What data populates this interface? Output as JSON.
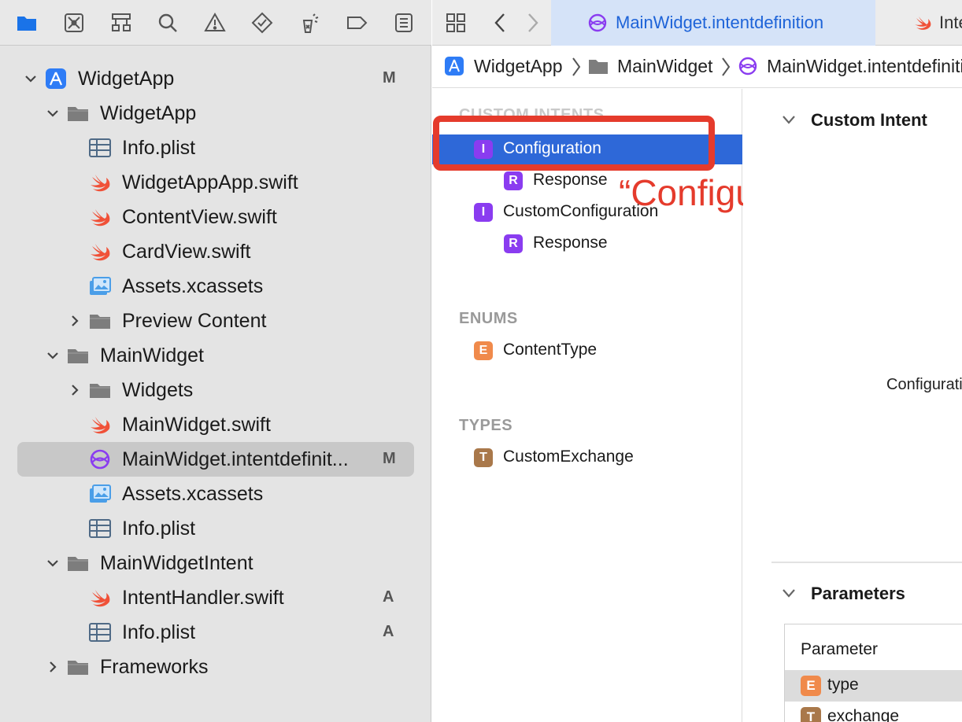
{
  "colors": {
    "accent": "#2e68d8",
    "tab_active_bg": "#d5e3f8",
    "annotation_red": "#e53b2c",
    "intent_purple": "#8a3cf0",
    "enum_orange": "#f08a4b",
    "type_brown": "#a9784a",
    "swift_orange": "#f05138"
  },
  "navigator": {
    "toolbar_icons": [
      "folder-icon",
      "source-control-icon",
      "hierarchy-icon",
      "search-icon",
      "warning-icon",
      "test-icon",
      "debug-icon",
      "breakpoint-icon",
      "report-icon"
    ],
    "tree": [
      {
        "label": "WidgetApp",
        "icon": "app-project-icon",
        "depth": 0,
        "chevron": "down",
        "badge": "M"
      },
      {
        "label": "WidgetApp",
        "icon": "folder-icon",
        "depth": 1,
        "chevron": "down",
        "badge": ""
      },
      {
        "label": "Info.plist",
        "icon": "plist-icon",
        "depth": 2,
        "chevron": "",
        "badge": ""
      },
      {
        "label": "WidgetAppApp.swift",
        "icon": "swift-icon",
        "depth": 2,
        "chevron": "",
        "badge": ""
      },
      {
        "label": "ContentView.swift",
        "icon": "swift-icon",
        "depth": 2,
        "chevron": "",
        "badge": ""
      },
      {
        "label": "CardView.swift",
        "icon": "swift-icon",
        "depth": 2,
        "chevron": "",
        "badge": ""
      },
      {
        "label": "Assets.xcassets",
        "icon": "assets-icon",
        "depth": 2,
        "chevron": "",
        "badge": ""
      },
      {
        "label": "Preview Content",
        "icon": "folder-icon",
        "depth": 2,
        "chevron": "right",
        "badge": ""
      },
      {
        "label": "MainWidget",
        "icon": "folder-icon",
        "depth": 1,
        "chevron": "down",
        "badge": ""
      },
      {
        "label": "Widgets",
        "icon": "folder-icon",
        "depth": 2,
        "chevron": "right",
        "badge": ""
      },
      {
        "label": "MainWidget.swift",
        "icon": "swift-icon",
        "depth": 2,
        "chevron": "",
        "badge": ""
      },
      {
        "label": "MainWidget.intentdefinit...",
        "icon": "intent-definition-icon",
        "depth": 2,
        "chevron": "",
        "badge": "M",
        "selected": true
      },
      {
        "label": "Assets.xcassets",
        "icon": "assets-icon",
        "depth": 2,
        "chevron": "",
        "badge": ""
      },
      {
        "label": "Info.plist",
        "icon": "plist-icon",
        "depth": 2,
        "chevron": "",
        "badge": ""
      },
      {
        "label": "MainWidgetIntent",
        "icon": "folder-icon",
        "depth": 1,
        "chevron": "down",
        "badge": ""
      },
      {
        "label": "IntentHandler.swift",
        "icon": "swift-icon",
        "depth": 2,
        "chevron": "",
        "badge": "A"
      },
      {
        "label": "Info.plist",
        "icon": "plist-icon",
        "depth": 2,
        "chevron": "",
        "badge": "A"
      },
      {
        "label": "Frameworks",
        "icon": "folder-icon",
        "depth": 1,
        "chevron": "right",
        "badge": ""
      }
    ]
  },
  "tabs": {
    "active_label": "MainWidget.intentdefinition",
    "other_label": "IntentHandler.swift"
  },
  "breadcrumb": {
    "project": "WidgetApp",
    "group": "MainWidget",
    "file": "MainWidget.intentdefinition"
  },
  "intent_list": {
    "custom_intents_header": "CUSTOM INTENTS",
    "items": [
      {
        "chip": "I",
        "label": "Configuration",
        "kind": "intent",
        "selected": true
      },
      {
        "chip": "R",
        "label": "Response",
        "kind": "response"
      },
      {
        "chip": "I",
        "label": "CustomConfiguration",
        "kind": "intent"
      },
      {
        "chip": "R",
        "label": "Response",
        "kind": "response"
      }
    ],
    "enums_header": "ENUMS",
    "enums": [
      {
        "chip": "E",
        "label": "ContentType"
      }
    ],
    "types_header": "TYPES",
    "types": [
      {
        "chip": "T",
        "label": "CustomExchange"
      }
    ]
  },
  "annotation": {
    "text": "“Configuration”"
  },
  "detail": {
    "custom_intent_title": "Custom Intent",
    "config_text": "Configuration",
    "parameters_title": "Parameters",
    "param_header": "Parameter",
    "params": [
      {
        "chip": "E",
        "label": "type"
      },
      {
        "chip": "T",
        "label": "exchange"
      }
    ]
  }
}
